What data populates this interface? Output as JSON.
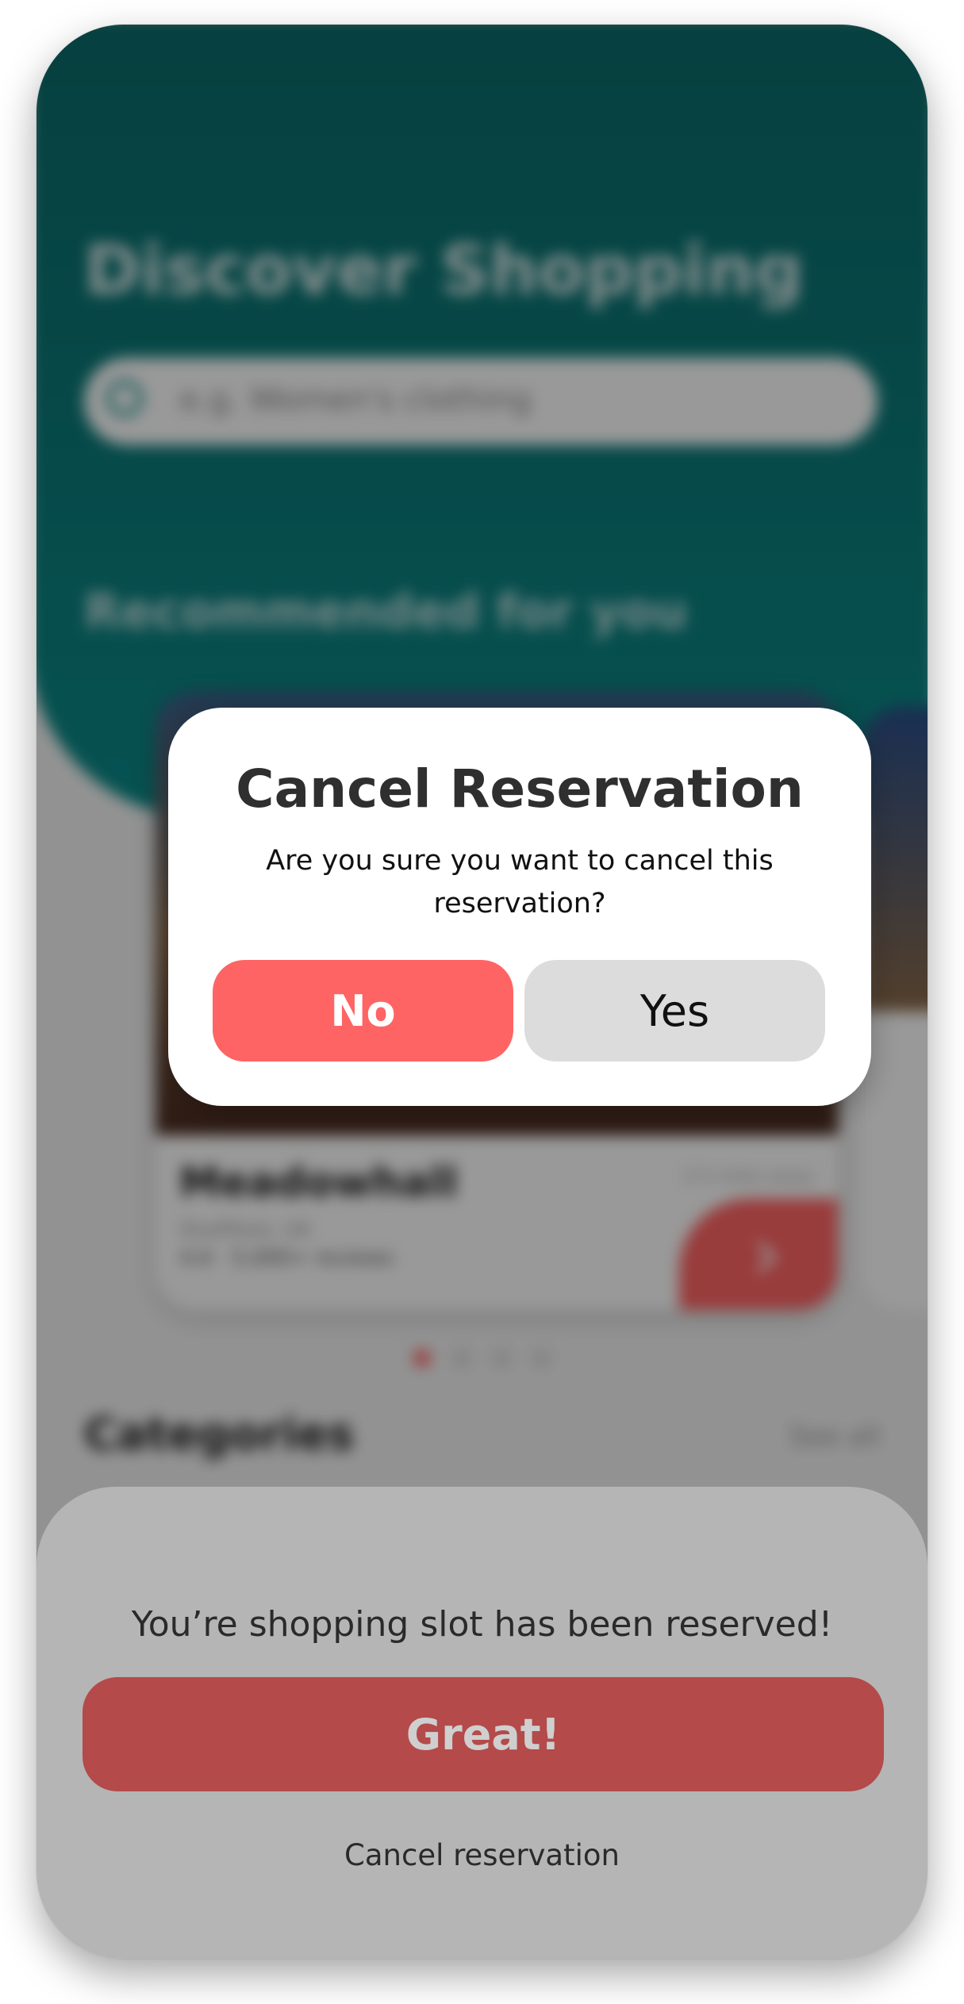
{
  "background_app": {
    "title": "Discover Shopping",
    "search_placeholder": "e.g. Women's clothing",
    "section_recommended": "Recommended for you",
    "card": {
      "name": "Meadowhall",
      "subtitle": "Sheffield, UK",
      "rating": "4.6 · 5,000+ reviews",
      "distance": "2.5 miles away"
    },
    "section_categories": "Categories",
    "see_all": "See all",
    "pagination": {
      "total": 4,
      "active": 1
    }
  },
  "sheet": {
    "message": "You’re shopping slot has been reserved!",
    "primary_button": "Great!",
    "cancel_link": "Cancel reservation"
  },
  "modal": {
    "title": "Cancel Reservation",
    "body": "Are you sure you want to cancel this reservation?",
    "no_button": "No",
    "yes_button": "Yes"
  },
  "colors": {
    "teal": "#0b8a89",
    "accent_red": "#ff6464",
    "neutral_button": "#dcdcdc"
  }
}
